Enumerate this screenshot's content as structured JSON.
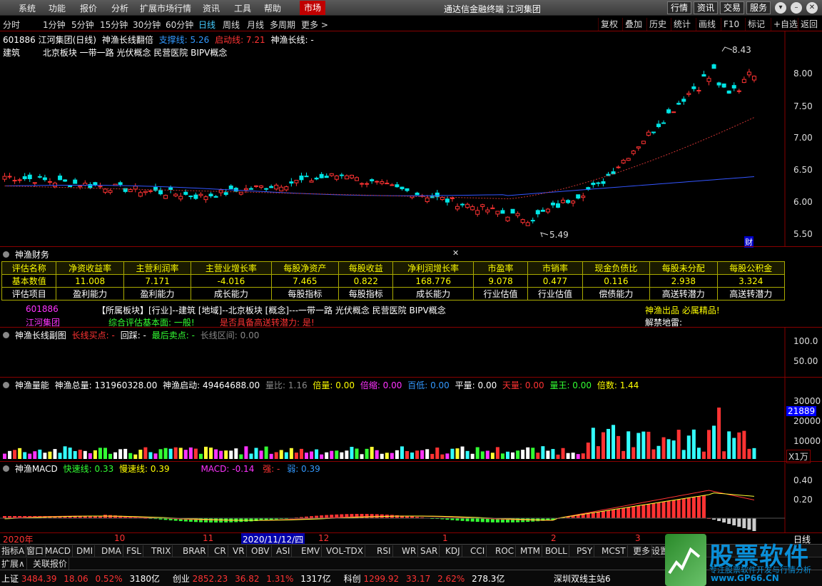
{
  "menubar": {
    "items": [
      "系统",
      "功能",
      "报价",
      "分析",
      "扩展市场行情",
      "资讯",
      "工具",
      "帮助"
    ],
    "market_tab": "市场",
    "app_title": "通达信金融终端  江河集团",
    "right_buttons": [
      "行情",
      "资讯",
      "交易",
      "服务"
    ]
  },
  "periods": {
    "items": [
      "分时",
      "1分钟",
      "5分钟",
      "15分钟",
      "30分钟",
      "60分钟",
      "日线",
      "周线",
      "月线",
      "多周期",
      "更多 >"
    ],
    "active": "日线"
  },
  "toolbar": {
    "items": [
      "复权",
      "叠加",
      "历史",
      "统计",
      "画线",
      "F10",
      "标记",
      "+自选",
      "返回"
    ]
  },
  "main": {
    "code_title": "601886 江河集团(日线)",
    "indicator_name": "神渔长线翻倍",
    "support_label": "支撑线: 5.26",
    "start_label": "启动线: 7.21",
    "longline_label": "神渔长线: -",
    "industry": "建筑",
    "concepts": "北京板块  一带一路 光伏概念 民营医院 BIPV概念",
    "high_mark": "8.43",
    "low_mark": "5.49",
    "cai_badge": "财",
    "yaxis": [
      "8.00",
      "7.50",
      "7.00",
      "6.50",
      "6.00",
      "5.50"
    ]
  },
  "finance": {
    "title": "神渔财务",
    "headers": [
      "评估名称",
      "净资收益率",
      "主营利润率",
      "主营业增长率",
      "每股净资产",
      "每股收益",
      "净利润增长率",
      "市盈率",
      "市销率",
      "现金负债比",
      "每股未分配",
      "每股公积金"
    ],
    "values": [
      "基本数值",
      "11.008",
      "7.171",
      "-4.016",
      "7.465",
      "0.822",
      "168.776",
      "9.078",
      "0.477",
      "0.116",
      "2.938",
      "3.324"
    ],
    "items": [
      "评估项目",
      "盈利能力",
      "盈利能力",
      "成长能力",
      "每股指标",
      "每股指标",
      "成长能力",
      "行业估值",
      "行业估值",
      "偿债能力",
      "高送转潜力",
      "高送转潜力"
    ],
    "info_code": "601886",
    "info_name": "江河集团",
    "info_sector": "【所属板块】[行业]--建筑 [地域]--北京板块 [概念]---一带一路 光伏概念 民营医院 BIPV概念",
    "info_eval": "综合评估基本面: 一般!",
    "info_transfer": "是否具备高送转潜力: 是!",
    "info_quality": "神渔出品 必属精品!",
    "info_unlock": "解禁地雷:"
  },
  "sub1": {
    "title": "神渔长线副图",
    "buy": "长线买点: -",
    "pullback": "回踩: -",
    "sell": "最后卖点: -",
    "range": "长线区间: 0.00",
    "yaxis": [
      "100.0",
      "50.00"
    ]
  },
  "volume": {
    "title": "神渔量能",
    "total": "神渔总量: 131960328.00",
    "start": "神渔启动: 49464688.00",
    "ratio": "量比: 1.16",
    "double": "倍量: 0.00",
    "shrink": "倍缩: 0.00",
    "lowest": "百低: 0.00",
    "flat": "平量: 0.00",
    "sky": "天量: 0.00",
    "king": "量王: 0.00",
    "multiple": "倍数: 1.44",
    "yaxis": [
      "30000",
      "20000",
      "10000"
    ],
    "current": "21889",
    "unit": "X1万"
  },
  "macd": {
    "title": "神渔MACD",
    "fast": "快速线: 0.33",
    "slow": "慢速线: 0.39",
    "macd": "MACD: -0.14",
    "strong": "强: -",
    "weak": "弱: 0.39",
    "yaxis": [
      "0.40",
      "0.20"
    ]
  },
  "dateaxis": {
    "labels": [
      "2020年",
      "10",
      "11",
      "2020/11/12/四",
      "12",
      "1",
      "2",
      "3"
    ],
    "period": "日线"
  },
  "bottom_tabs": [
    "指标A",
    "窗口",
    "MACD",
    "DMI",
    "DMA",
    "FSL",
    "TRIX",
    "BRAR",
    "CR",
    "VR",
    "OBV",
    "ASI",
    "EMV",
    "VOL-TDX",
    "RSI",
    "WR",
    "SAR",
    "KDJ",
    "CCI",
    "ROC",
    "MTM",
    "BOLL",
    "PSY",
    "MCST",
    "更多",
    "设置"
  ],
  "extra_tabs": [
    "扩展∧",
    "关联报价"
  ],
  "status": {
    "sh_name": "上证",
    "sh_val": "3484.39",
    "sh_chg": "18.06",
    "sh_pct": "0.52%",
    "sh_amt": "3180亿",
    "cy_name": "创业",
    "cy_val": "2852.23",
    "cy_chg": "36.82",
    "cy_pct": "1.31%",
    "cy_amt": "1317亿",
    "kc_name": "科创",
    "kc_val": "1299.92",
    "kc_chg": "33.17",
    "kc_pct": "2.62%",
    "kc_amt": "278.3亿",
    "station": "深圳双线主站6"
  },
  "watermark": {
    "brand": "股票软件",
    "url": "www.GP66.CN",
    "slogan": "专注股票软件开发与行情分析"
  }
}
